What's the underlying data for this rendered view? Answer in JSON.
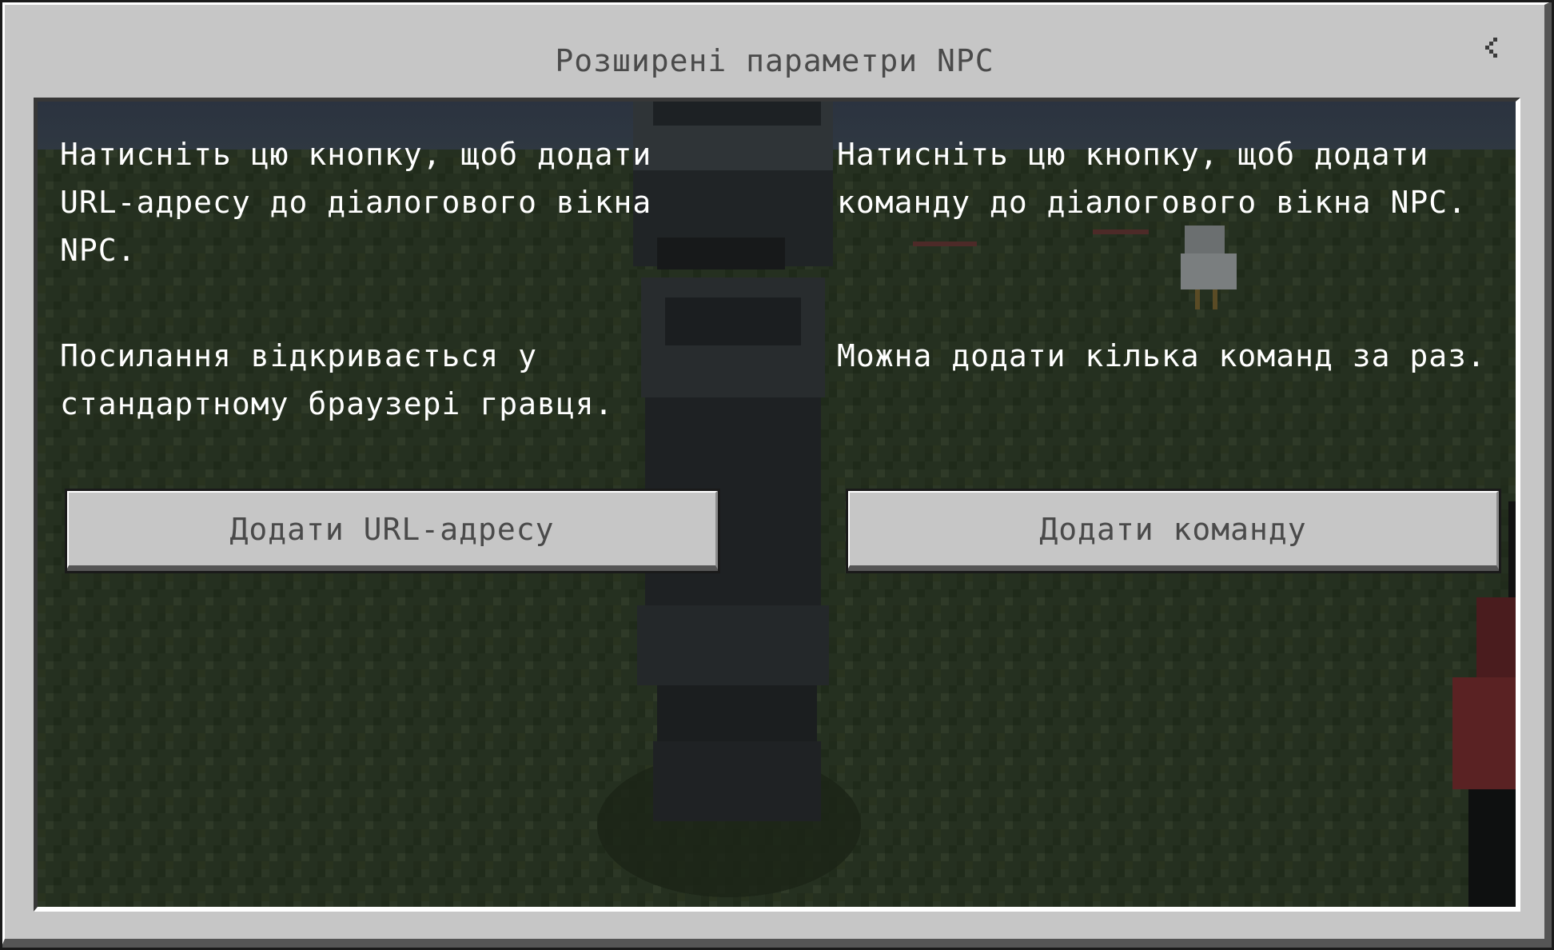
{
  "dialog": {
    "title": "Розширені параметри NPC",
    "back_icon": "chevron-left-icon"
  },
  "url_section": {
    "description": "Натисніть цю кнопку, щоб додати\nURL-адресу до діалогового вікна\nNPC.",
    "note": "Посилання відкривається у\nстандартному браузері гравця.",
    "button_label": "Додати URL-адресу"
  },
  "command_section": {
    "description": "Натисніть цю кнопку, щоб додати\nкоманду до діалогового вікна NPC.",
    "note": "Можна додати кілька команд за раз.",
    "button_label": "Додати команду"
  },
  "colors": {
    "panel": "#c6c6c6",
    "button_text": "#4a4a4a",
    "body_text": "#ffffff"
  }
}
